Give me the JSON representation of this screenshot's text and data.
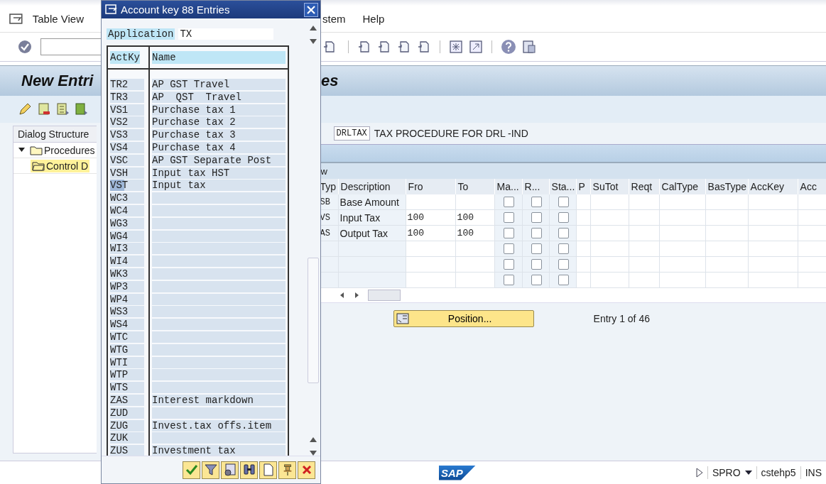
{
  "menu_bar": {
    "left": [
      {
        "label": "Table View"
      }
    ],
    "right": [
      {
        "label": "stem"
      },
      {
        "label": "Help"
      }
    ]
  },
  "screen_title": {
    "left": "New Entri",
    "right": "es"
  },
  "dialog_structure": {
    "header": "Dialog Structure",
    "items": [
      {
        "label": "Procedures",
        "expanded": true,
        "selected": false,
        "children": [
          {
            "label": "Control D",
            "selected": true
          }
        ]
      }
    ]
  },
  "procedure": {
    "code": "DRLTAX",
    "description": "TAX PROCEDURE FOR DRL -IND"
  },
  "table": {
    "title": "w",
    "columns": [
      {
        "label": "Typ",
        "kind": "text"
      },
      {
        "label": "Description",
        "kind": "text"
      },
      {
        "label": "Fro",
        "kind": "mono"
      },
      {
        "label": "To",
        "kind": "mono"
      },
      {
        "label": "Ma...",
        "kind": "check"
      },
      {
        "label": "R...",
        "kind": "check"
      },
      {
        "label": "Sta...",
        "kind": "check"
      },
      {
        "label": "P",
        "kind": "text"
      },
      {
        "label": "SuTot",
        "kind": "text"
      },
      {
        "label": "Reqt",
        "kind": "text"
      },
      {
        "label": "CalType",
        "kind": "text"
      },
      {
        "label": "BasType",
        "kind": "text"
      },
      {
        "label": "AccKey",
        "kind": "text"
      },
      {
        "label": "Acc",
        "kind": "text"
      }
    ],
    "rows": [
      {
        "typ": "SB",
        "description": "Base Amount",
        "from": "",
        "to": "",
        "ma": false,
        "r": false,
        "sta": false
      },
      {
        "typ": "VS",
        "description": "Input Tax",
        "from": "100",
        "to": "100",
        "ma": false,
        "r": false,
        "sta": false
      },
      {
        "typ": "AS",
        "description": "Output Tax",
        "from": "100",
        "to": "100",
        "ma": false,
        "r": false,
        "sta": false
      },
      {
        "typ": "",
        "description": "",
        "from": "",
        "to": "",
        "ma": false,
        "r": false,
        "sta": false
      },
      {
        "typ": "",
        "description": "",
        "from": "",
        "to": "",
        "ma": false,
        "r": false,
        "sta": false
      },
      {
        "typ": "",
        "description": "",
        "from": "",
        "to": "",
        "ma": false,
        "r": false,
        "sta": false
      }
    ]
  },
  "position_button": "Position...",
  "entry_count": "Entry 1 of 46",
  "status_bar": {
    "logo": "SAP",
    "transaction": "SPRO",
    "server": "cstehp5",
    "mode": "INS"
  },
  "popup": {
    "title": "Account key 88 Entries",
    "application_label": "Application",
    "application_value": "TX",
    "columns": [
      "ActKy",
      "Name"
    ],
    "rows": [
      {
        "key": "TR2",
        "name": "AP GST Travel",
        "focused": false
      },
      {
        "key": "TR3",
        "name": "AP  QST  Travel",
        "focused": false
      },
      {
        "key": "VS1",
        "name": "Purchase tax 1",
        "focused": false
      },
      {
        "key": "VS2",
        "name": "Purchase tax 2",
        "focused": false
      },
      {
        "key": "VS3",
        "name": "Purchase tax 3",
        "focused": false
      },
      {
        "key": "VS4",
        "name": "Purchase tax 4",
        "focused": false
      },
      {
        "key": "VSC",
        "name": "AP GST Separate Post",
        "focused": false
      },
      {
        "key": "VSH",
        "name": "Input tax HST",
        "focused": false
      },
      {
        "key": "VST",
        "name": "Input tax",
        "focused": true
      },
      {
        "key": "WC3",
        "name": "",
        "focused": false
      },
      {
        "key": "WC4",
        "name": "",
        "focused": false
      },
      {
        "key": "WG3",
        "name": "",
        "focused": false
      },
      {
        "key": "WG4",
        "name": "",
        "focused": false
      },
      {
        "key": "WI3",
        "name": "",
        "focused": false
      },
      {
        "key": "WI4",
        "name": "",
        "focused": false
      },
      {
        "key": "WK3",
        "name": "",
        "focused": false
      },
      {
        "key": "WP3",
        "name": "",
        "focused": false
      },
      {
        "key": "WP4",
        "name": "",
        "focused": false
      },
      {
        "key": "WS3",
        "name": "",
        "focused": false
      },
      {
        "key": "WS4",
        "name": "",
        "focused": false
      },
      {
        "key": "WTC",
        "name": "",
        "focused": false
      },
      {
        "key": "WTG",
        "name": "",
        "focused": false
      },
      {
        "key": "WTI",
        "name": "",
        "focused": false
      },
      {
        "key": "WTP",
        "name": "",
        "focused": false
      },
      {
        "key": "WTS",
        "name": "",
        "focused": false
      },
      {
        "key": "ZAS",
        "name": "Interest markdown",
        "focused": false
      },
      {
        "key": "ZUD",
        "name": "",
        "focused": false
      },
      {
        "key": "ZUG",
        "name": "Invest.tax offs.item",
        "focused": false
      },
      {
        "key": "ZUK",
        "name": "",
        "focused": false
      },
      {
        "key": "ZUS",
        "name": "Investment tax",
        "focused": false
      }
    ]
  }
}
